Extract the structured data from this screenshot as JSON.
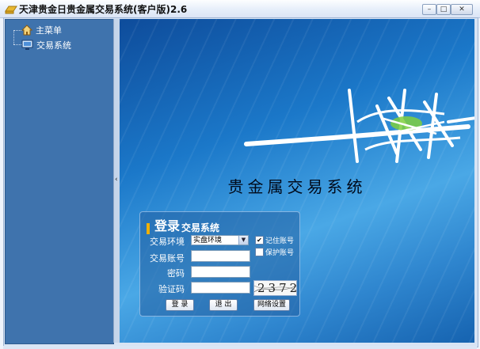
{
  "window": {
    "title": "天津贵金日贵金属交易系统(客户版)2.6",
    "buttons": {
      "minimize": "–",
      "maximize": "□",
      "close": "✕"
    }
  },
  "sidebar": {
    "items": [
      {
        "label": "主菜单",
        "icon": "home-icon"
      },
      {
        "label": "交易系统",
        "icon": "monitor-icon"
      }
    ]
  },
  "splitter": {
    "arrow": "‹"
  },
  "banner": {
    "title": "贵金属交易系统"
  },
  "login": {
    "heading_big": "登录",
    "heading_small": "交易系统",
    "env_label": "交易环境",
    "env_value": "实盘环境",
    "account_label": "交易账号",
    "account_value": "",
    "password_label": "密码",
    "password_value": "",
    "captcha_label": "验证码",
    "captcha_value": "",
    "captcha_text": "2372",
    "remember_label": "记住账号",
    "remember_checked": true,
    "protect_label": "保护账号",
    "protect_checked": false,
    "login_button": "登 录",
    "exit_button": "退 出",
    "network_button": "网络设置"
  },
  "colors": {
    "sidebar": "#3f73ad",
    "accent": "#f0b000",
    "banner_dark": "#0e4c9b",
    "banner_light": "#4aa8e6"
  }
}
